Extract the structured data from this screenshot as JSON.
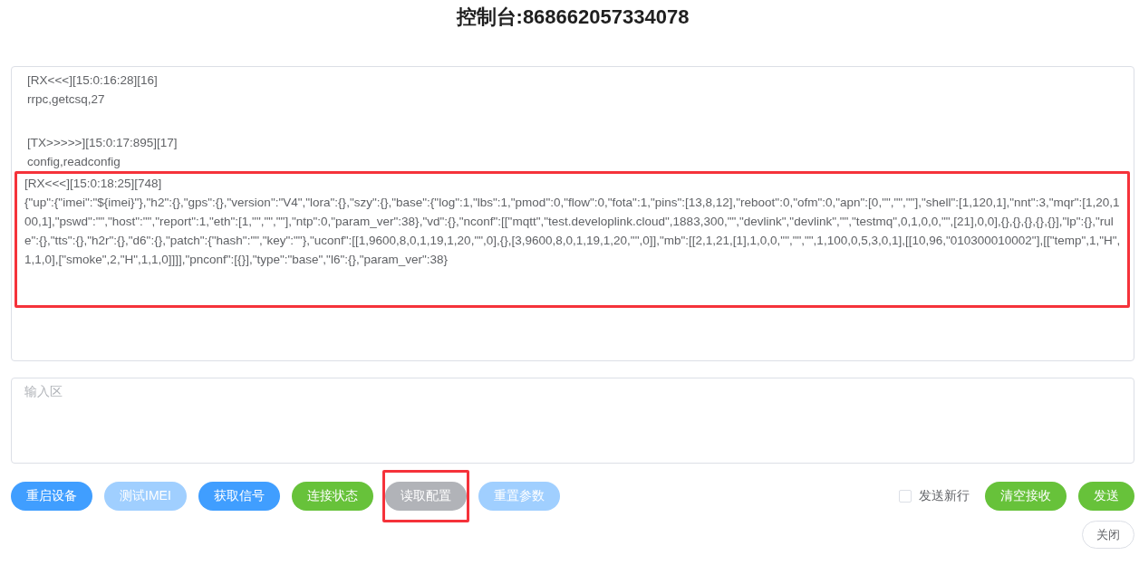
{
  "title": "控制台:868662057334078",
  "log": [
    {
      "header": "[RX<<<][15:0:16:28][16]",
      "body": "rrpc,getcsq,27",
      "highlighted": false
    },
    {
      "header": "[TX>>>>>][15:0:17:895][17]",
      "body": "config,readconfig",
      "highlighted": false
    },
    {
      "header": "[RX<<<][15:0:18:25][748]",
      "body": "{\"up\":{\"imei\":\"${imei}\"},\"h2\":{},\"gps\":{},\"version\":\"V4\",\"lora\":{},\"szy\":{},\"base\":{\"log\":1,\"lbs\":1,\"pmod\":0,\"flow\":0,\"fota\":1,\"pins\":[13,8,12],\"reboot\":0,\"ofm\":0,\"apn\":[0,\"\",\"\",\"\"],\"shell\":[1,120,1],\"nnt\":3,\"mqr\":[1,20,100,1],\"pswd\":\"\",\"host\":\"\",\"report\":1,\"eth\":[1,\"\",\"\",\"\"],\"ntp\":0,\"param_ver\":38},\"vd\":{},\"nconf\":[[\"mqtt\",\"test.developlink.cloud\",1883,300,\"\",\"devlink\",\"devlink\",\"\",\"testmq\",0,1,0,0,\"\",[21],0,0],{},{},{},{},{}],\"lp\":{},\"rule\":{},\"tts\":{},\"h2r\":{},\"d6\":{},\"patch\":{\"hash\":\"\",\"key\":\"\"},\"uconf\":[[1,9600,8,0,1,19,1,20,\"\",0],{},[3,9600,8,0,1,19,1,20,\"\",0]],\"mb\":[[2,1,21,[1],1,0,0,\"\",\"\",\"\",1,100,0,5,3,0,1],[[10,96,\"010300010002\"],[[\"temp\",1,\"H\",1,1,0],[\"smoke\",2,\"H\",1,1,0]]]],\"pnconf\":[{}],\"type\":\"base\",\"l6\":{},\"param_ver\":38}",
      "highlighted": true
    }
  ],
  "input": {
    "placeholder": "输入区"
  },
  "buttons": [
    {
      "label": "重启设备",
      "kind": "primary",
      "disabled": false,
      "highlighted": false
    },
    {
      "label": "测试IMEI",
      "kind": "primary",
      "disabled": true,
      "highlighted": false
    },
    {
      "label": "获取信号",
      "kind": "primary",
      "disabled": false,
      "highlighted": false
    },
    {
      "label": "连接状态",
      "kind": "success",
      "disabled": false,
      "highlighted": false
    },
    {
      "label": "读取配置",
      "kind": "info",
      "disabled": true,
      "highlighted": true
    },
    {
      "label": "重置参数",
      "kind": "primary",
      "disabled": true,
      "highlighted": false
    }
  ],
  "newline_checkbox": {
    "label": "发送新行",
    "checked": false
  },
  "right_buttons": [
    {
      "label": "清空接收",
      "kind": "success",
      "disabled": false,
      "highlighted": false
    },
    {
      "label": "发送",
      "kind": "success",
      "disabled": false,
      "highlighted": false
    }
  ],
  "close_button": {
    "label": "关闭"
  }
}
